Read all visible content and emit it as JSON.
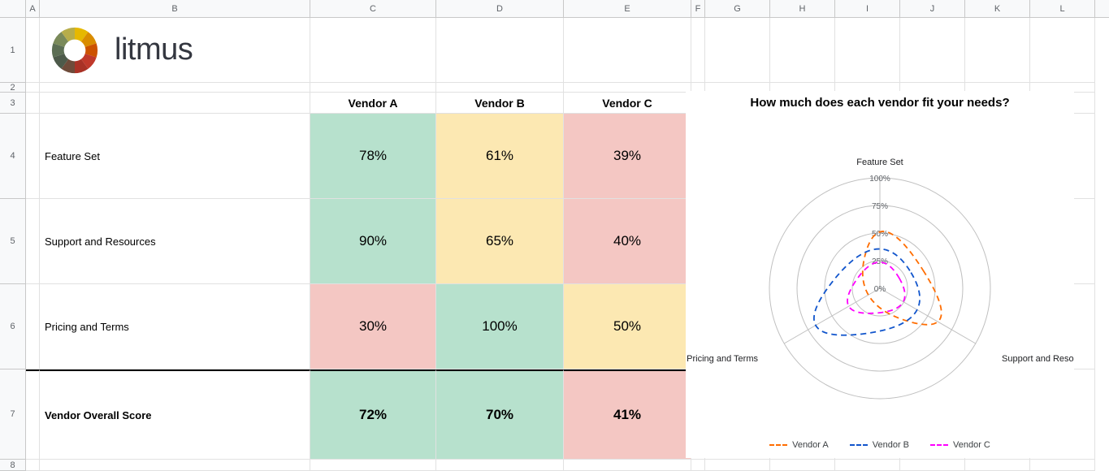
{
  "columns": [
    "A",
    "B",
    "C",
    "D",
    "E",
    "F",
    "G",
    "H",
    "I",
    "J",
    "K",
    "L"
  ],
  "rows": [
    "1",
    "2",
    "3",
    "4",
    "5",
    "6",
    "7",
    "8"
  ],
  "logo": {
    "text": "litmus"
  },
  "table": {
    "headers": {
      "c": "Vendor A",
      "d": "Vendor B",
      "e": "Vendor C"
    },
    "row_labels": {
      "feature": "Feature Set",
      "support": "Support and Resources",
      "pricing": "Pricing and Terms",
      "overall": "Vendor Overall Score"
    },
    "cells": {
      "feature": {
        "a": "78%",
        "b": "61%",
        "c": "39%"
      },
      "support": {
        "a": "90%",
        "b": "65%",
        "c": "40%"
      },
      "pricing": {
        "a": "30%",
        "b": "100%",
        "c": "50%"
      },
      "overall": {
        "a": "72%",
        "b": "70%",
        "c": "41%"
      }
    }
  },
  "chart": {
    "title": "How much does each vendor fit your needs?",
    "axis_labels": [
      "Feature Set",
      "Support and Resources",
      "Pricing and Terms"
    ],
    "ticks": [
      "0%",
      "25%",
      "50%",
      "75%",
      "100%"
    ],
    "legend": {
      "a": "Vendor A",
      "b": "Vendor B",
      "c": "Vendor C"
    }
  },
  "chart_data": {
    "type": "radar",
    "categories": [
      "Feature Set",
      "Support and Resources",
      "Pricing and Terms"
    ],
    "series": [
      {
        "name": "Vendor A",
        "values": [
          78,
          90,
          30
        ],
        "color": "#ff6d01"
      },
      {
        "name": "Vendor B",
        "values": [
          61,
          65,
          100
        ],
        "color": "#1155cc"
      },
      {
        "name": "Vendor C",
        "values": [
          39,
          40,
          50
        ],
        "color": "#ff00ff"
      }
    ],
    "title": "How much does each vendor fit your needs?",
    "ylim": [
      0,
      100
    ],
    "tick_labels": [
      "0%",
      "25%",
      "50%",
      "75%",
      "100%"
    ]
  }
}
